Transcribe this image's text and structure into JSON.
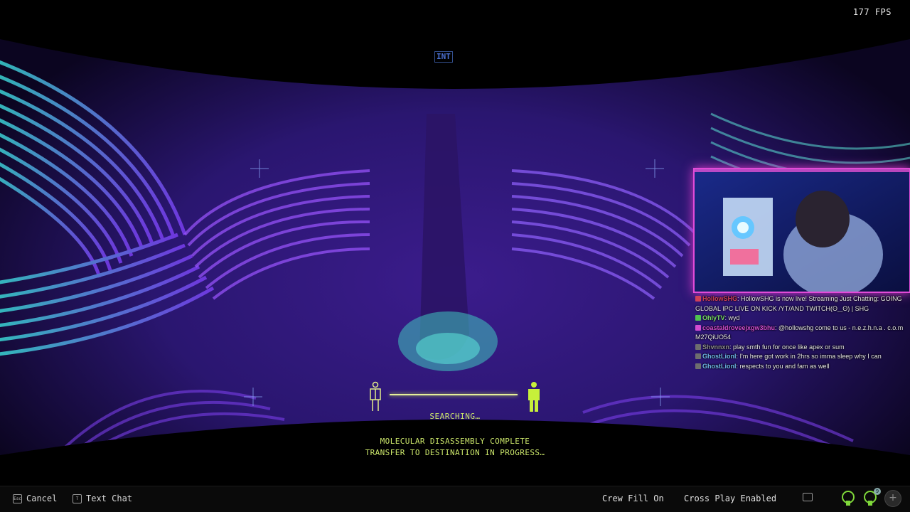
{
  "hud": {
    "fps": "177 FPS",
    "region": "INT",
    "region_ping": "",
    "searching": "SEARCHING…",
    "status_line_1": "MOLECULAR DISASSEMBLY COMPLETE",
    "status_line_2": "TRANSFER TO DESTINATION IN PROGRESS…"
  },
  "colors": {
    "accent": "#cbe66a",
    "cam_border": "#e24bd8",
    "bg": "#000000"
  },
  "webcam": {
    "label": "streamer webcam"
  },
  "chat": {
    "messages": [
      {
        "user": "HollowSHG",
        "text": ": HollowSHG is now live! Streaming Just Chatting: GOING GLOBAL IPC LIVE ON KICK /YT/AND TWITCH(ʘ‿ʘ) | SHG",
        "user_color": "#d0405a",
        "badge_color": "#d0405a"
      },
      {
        "user": "OhlyTV",
        "text": ": wyd",
        "user_color": "#7be06a",
        "badge_color": "#4fc24f"
      },
      {
        "user": "coastaldroveejxgw3bhu",
        "text": ": @hollowshg come to us - n.e.z.h.n.a . c.o.m M27QiUO54",
        "user_color": "#d24ccf",
        "badge_color": "#d24ccf"
      },
      {
        "user": "Shvnnxn",
        "text": ": play smth fun for once like apex or sum",
        "user_color": "#8d8d8d",
        "badge_color": "#6e6e6e"
      },
      {
        "user": "GhostLionl",
        "text": ": I'm here got work in 2hrs so imma sleep why I can",
        "user_color": "#6fb8e8",
        "badge_color": "#6e6e6e"
      },
      {
        "user": "GhostLionl",
        "text": ": respects to you and fam as well",
        "user_color": "#6fb8e8",
        "badge_color": "#6e6e6e"
      }
    ]
  },
  "bottombar": {
    "cancel_key": "Esc",
    "cancel_label": "Cancel",
    "textchat_key": "T",
    "textchat_label": "Text Chat",
    "crew_fill": "Crew Fill On",
    "crossplay": "Cross Play Enabled",
    "notif_count": "9",
    "plus": "+"
  }
}
